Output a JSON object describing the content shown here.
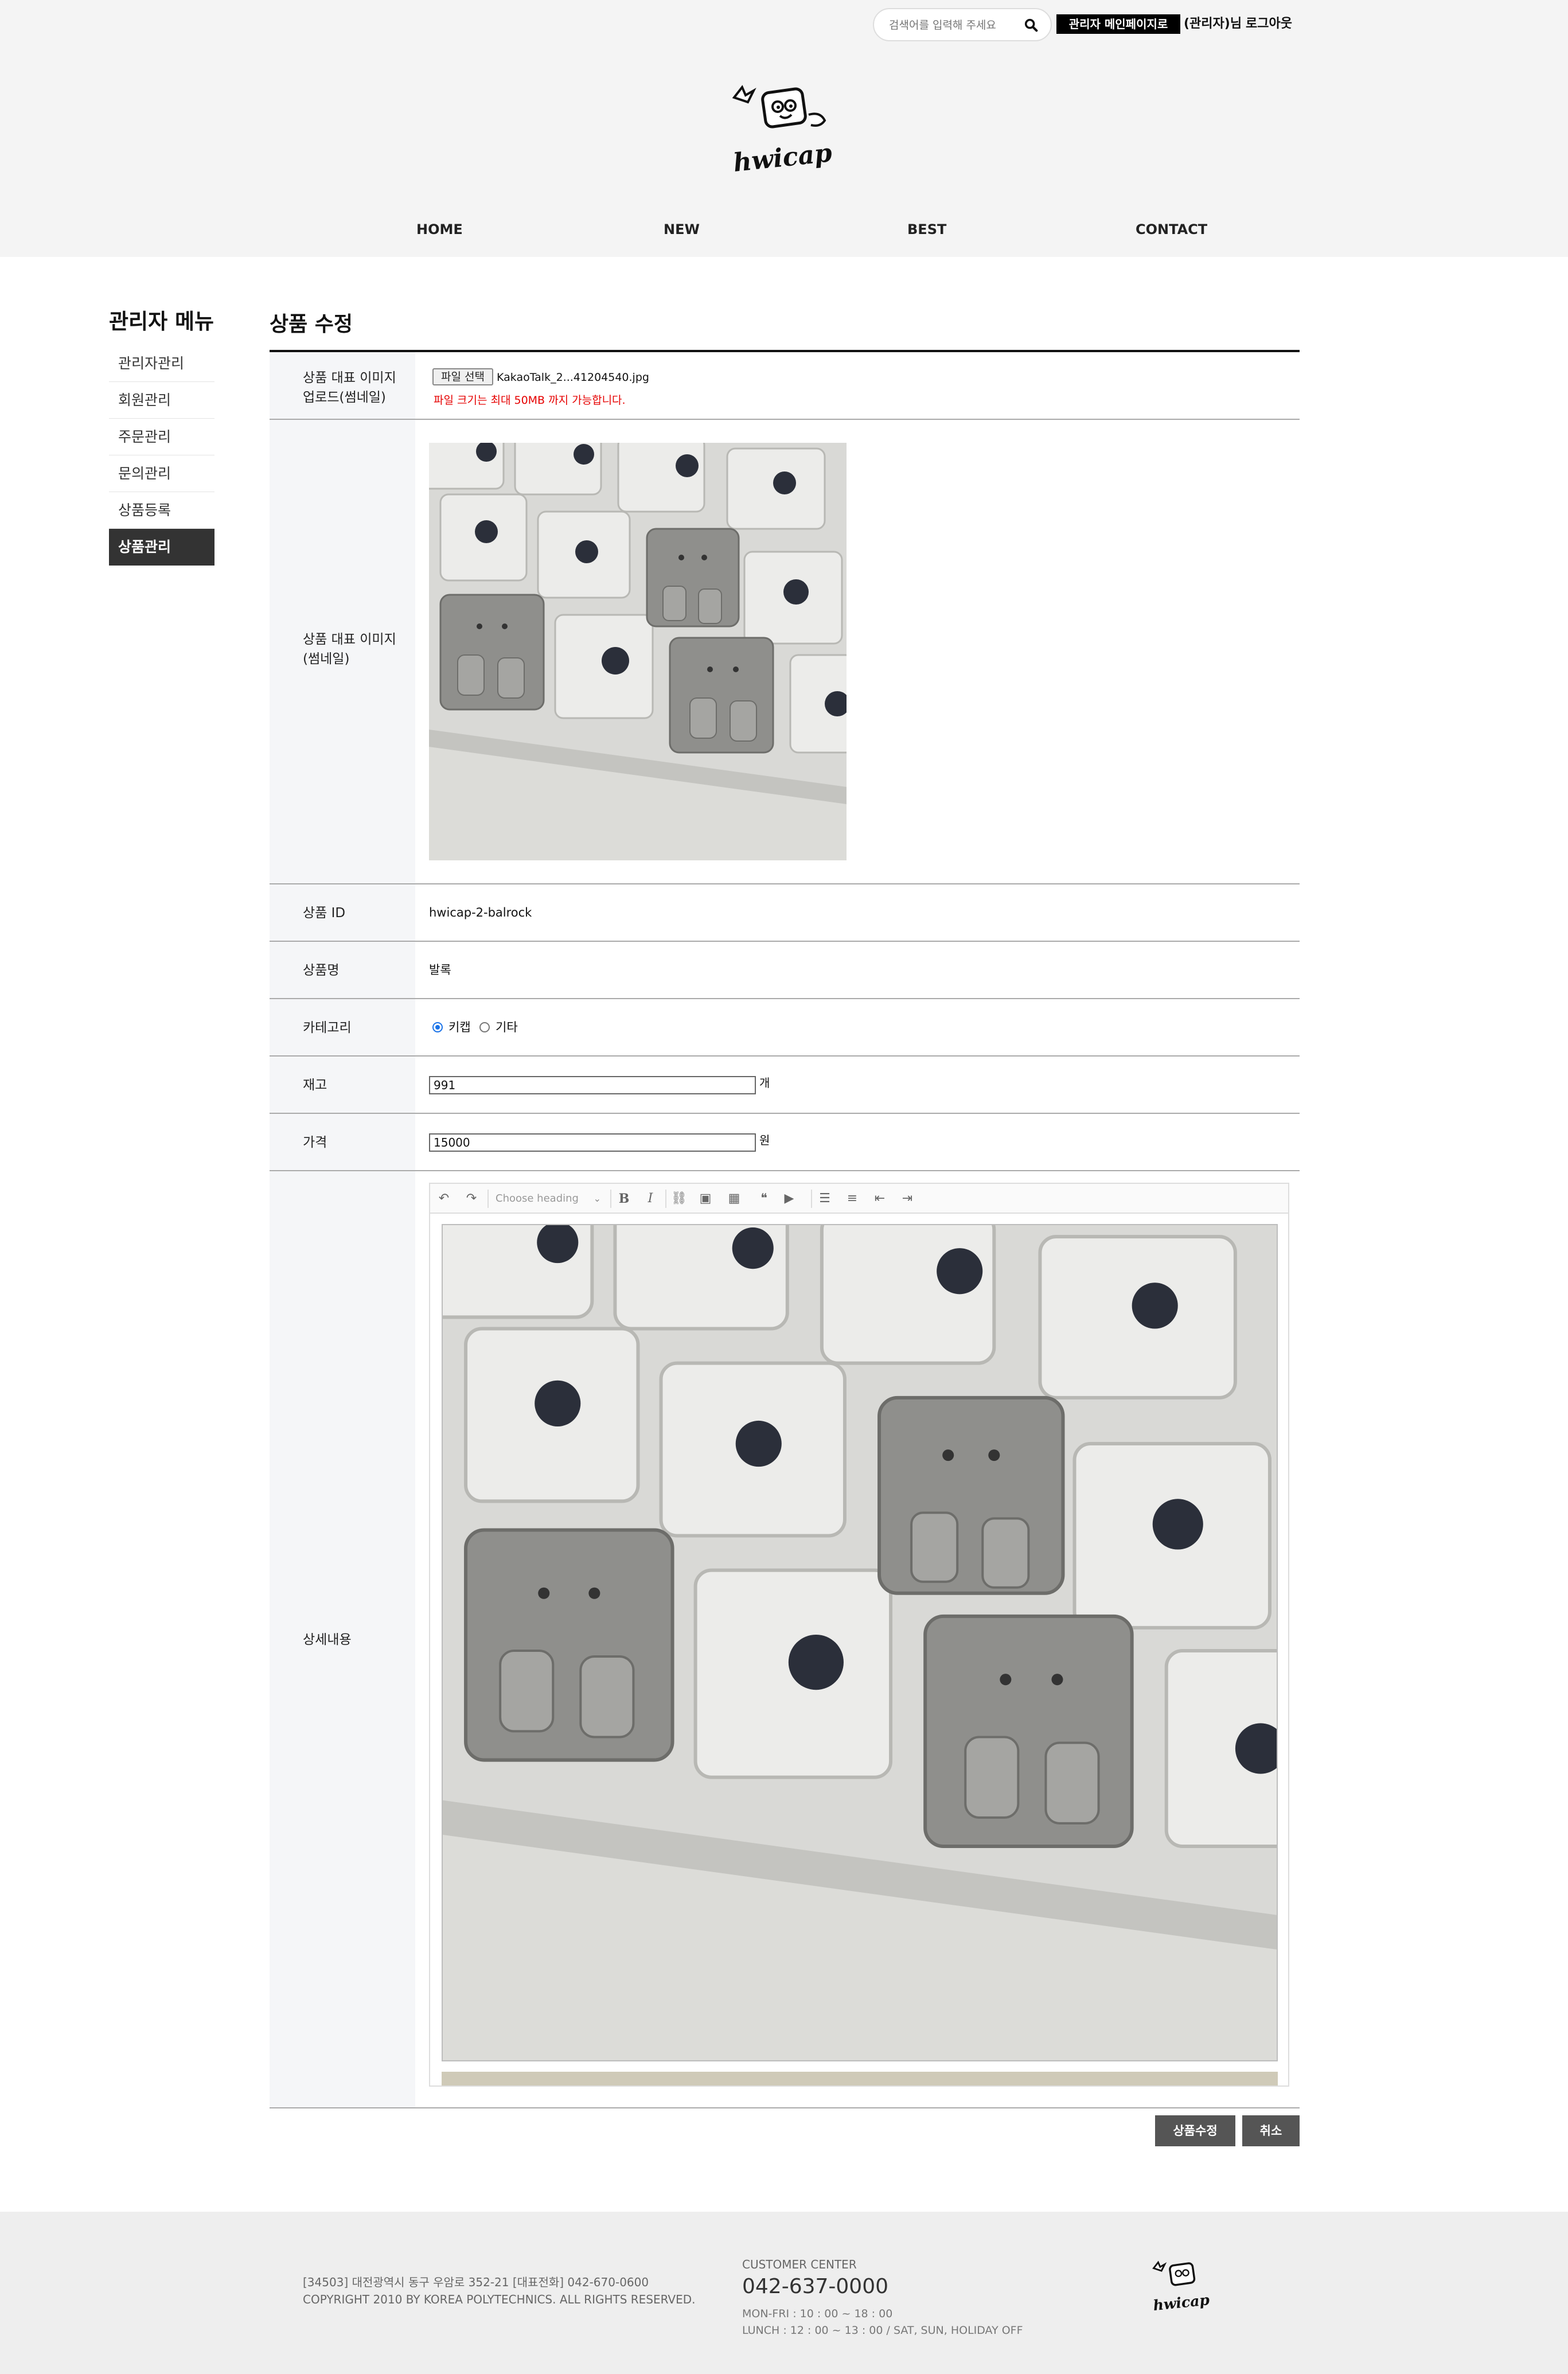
{
  "header": {
    "search_placeholder": "검색어를 입력해 주세요",
    "admin_main_label": "관리자 메인페이지로",
    "admin_name": "(관리자)님",
    "logout_label": "로그아웃",
    "logo_text": "hwicap",
    "nav": [
      "HOME",
      "NEW",
      "BEST",
      "CONTACT"
    ]
  },
  "sidebar": {
    "title": "관리자 메뉴",
    "items": [
      {
        "label": "관리자관리",
        "active": false
      },
      {
        "label": "회원관리",
        "active": false
      },
      {
        "label": "주문관리",
        "active": false
      },
      {
        "label": "문의관리",
        "active": false
      },
      {
        "label": "상품등록",
        "active": false
      },
      {
        "label": "상품관리",
        "active": true
      }
    ]
  },
  "main": {
    "title": "상품 수정",
    "upload": {
      "label_line1": "상품 대표 이미지",
      "label_line2": "업로드(썸네일)",
      "file_button": "파일 선택",
      "file_name": "KakaoTalk_2...41204540.jpg",
      "warning": "파일 크기는 최대 50MB 까지 가능합니다."
    },
    "thumbnail": {
      "label_line1": "상품 대표 이미지",
      "label_line2": "(썸네일)"
    },
    "product_id": {
      "label": "상품 ID",
      "value": "hwicap-2-balrock"
    },
    "product_name": {
      "label": "상품명",
      "value": "발록"
    },
    "category": {
      "label": "카테고리",
      "options": [
        {
          "label": "키캡",
          "checked": true
        },
        {
          "label": "기타",
          "checked": false
        }
      ]
    },
    "stock": {
      "label": "재고",
      "value": "991",
      "unit": "개"
    },
    "price": {
      "label": "가격",
      "value": "15000",
      "unit": "원"
    },
    "detail": {
      "label": "상세내용",
      "heading_placeholder": "Choose heading",
      "toolbar_icons": [
        "undo-icon",
        "redo-icon",
        "bold-icon",
        "italic-icon",
        "link-icon",
        "image-upload-icon",
        "table-icon",
        "blockquote-icon",
        "media-embed-icon",
        "bulleted-list-icon",
        "numbered-list-icon",
        "outdent-icon",
        "indent-icon"
      ]
    },
    "buttons": {
      "submit": "상품수정",
      "cancel": "취소"
    }
  },
  "footer": {
    "address": "[34503] 대전광역시 동구 우암로 352-21 [대표전화] 042-670-0600",
    "copyright": "COPYRIGHT 2010 BY KOREA POLYTECHNICS. ALL RIGHTS RESERVED.",
    "cc_title": "CUSTOMER CENTER",
    "cc_phone": "042-637-0000",
    "cc_hours1": "MON-FRI : 10 : 00 ~ 18 : 00",
    "cc_hours2": "LUNCH : 12 : 00 ~ 13 : 00 / SAT, SUN, HOLIDAY OFF"
  }
}
